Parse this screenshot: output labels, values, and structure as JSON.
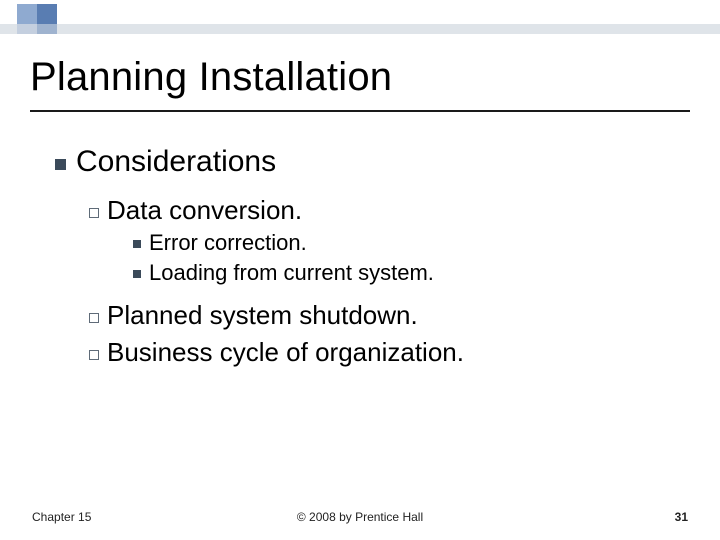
{
  "title": "Planning Installation",
  "lvl1": {
    "label": "Considerations"
  },
  "lvl2": {
    "item0": "Data conversion.",
    "item1": "Planned system shutdown.",
    "item2": "Business cycle of organization."
  },
  "lvl3": {
    "item0": "Error correction.",
    "item1": "Loading from current system."
  },
  "footer": {
    "left": "Chapter 15",
    "center": "© 2008 by Prentice Hall",
    "right": "31"
  }
}
